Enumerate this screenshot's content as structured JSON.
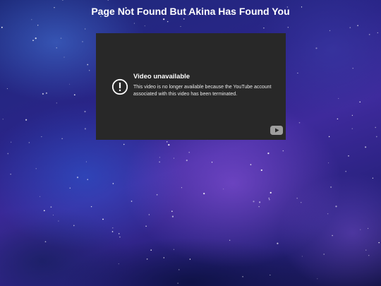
{
  "page": {
    "title": "Page Not Found But Akina Has Found You"
  },
  "video": {
    "error_title": "Video unavailable",
    "error_message": "This video is no longer available because the YouTube account associated with this video has been terminated.",
    "error_icon": "alert-circle-icon",
    "logo_icon": "youtube-logo-icon"
  },
  "colors": {
    "player_background": "#282828",
    "title_text": "#ffffff",
    "space_background": "#2a2488"
  }
}
